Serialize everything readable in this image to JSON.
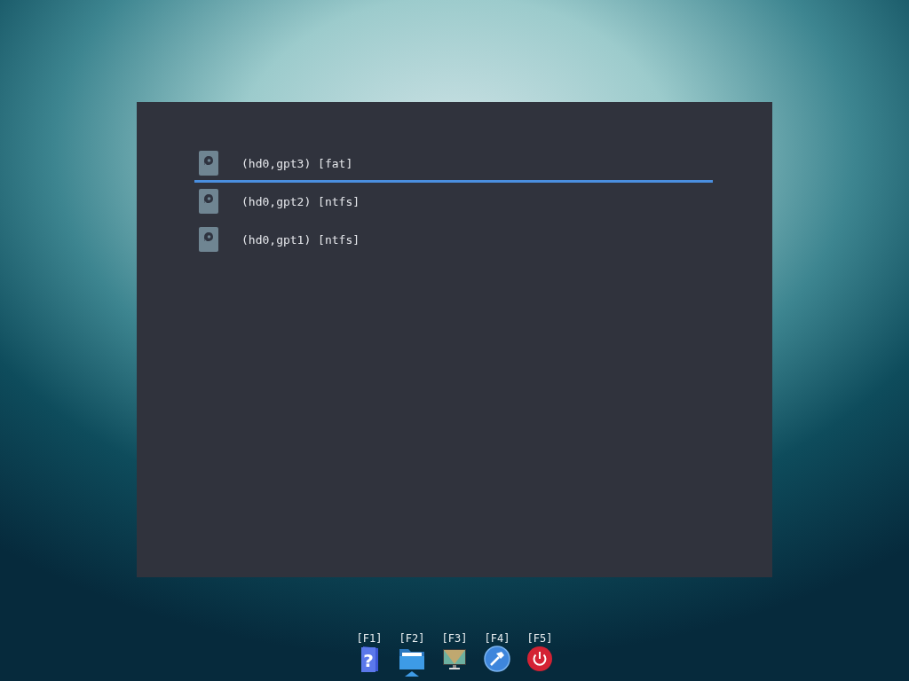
{
  "entries": [
    {
      "label": "(hd0,gpt3) [fat]",
      "selected": true
    },
    {
      "label": "(hd0,gpt2) [ntfs]",
      "selected": false
    },
    {
      "label": "(hd0,gpt1) [ntfs]",
      "selected": false
    }
  ],
  "dock": [
    {
      "key": "[F1]",
      "kind": "help",
      "glyph": "?",
      "selected": false
    },
    {
      "key": "[F2]",
      "kind": "folder",
      "selected": true
    },
    {
      "key": "[F3]",
      "kind": "display",
      "selected": false
    },
    {
      "key": "[F4]",
      "kind": "tools",
      "selected": false
    },
    {
      "key": "[F5]",
      "kind": "power",
      "selected": false
    }
  ]
}
